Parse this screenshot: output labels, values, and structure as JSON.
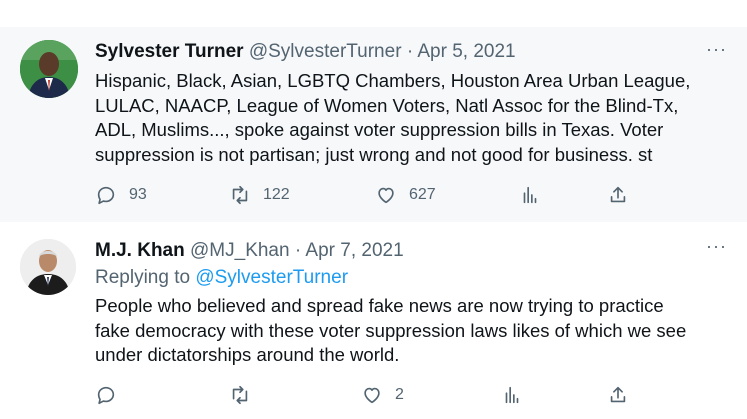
{
  "tweets": [
    {
      "name": "Sylvester Turner",
      "handle": "@SylvesterTurner",
      "dot": "·",
      "date": "Apr 5, 2021",
      "more": "···",
      "lines": [
        "Hispanic, Black, Asian, LGBTQ Chambers, Houston Area Urban League,",
        "LULAC, NAACP, League of Women Voters, Natl Assoc for the Blind-Tx,",
        "ADL, Muslims..., spoke against voter suppression bills in Texas. Voter",
        "suppression is not partisan; just wrong and not good for business. st"
      ],
      "actions": {
        "reply_count": "93",
        "retweet_count": "122",
        "like_count": "627"
      }
    },
    {
      "name": "M.J. Khan",
      "handle": "@MJ_Khan",
      "dot": "·",
      "date": "Apr 7, 2021",
      "more": "···",
      "replying_prefix": "Replying to ",
      "replying_mention": "@SylvesterTurner",
      "lines": [
        "People who believed and spread fake news are now trying to practice",
        "fake democracy with these voter suppression laws likes of which we see",
        "under dictatorships around the world."
      ],
      "actions": {
        "reply_count": "",
        "retweet_count": "",
        "like_count": "2"
      }
    }
  ],
  "icons": {
    "reply": "reply-icon",
    "retweet": "retweet-icon",
    "like": "heart-icon",
    "analytics": "analytics-icon",
    "share": "share-icon"
  },
  "colors": {
    "text": "#0f1419",
    "secondary": "#536471",
    "link": "#1d9bf0",
    "highlight_bg": "#f7f8f9",
    "thread_line": "#cfd9de"
  }
}
